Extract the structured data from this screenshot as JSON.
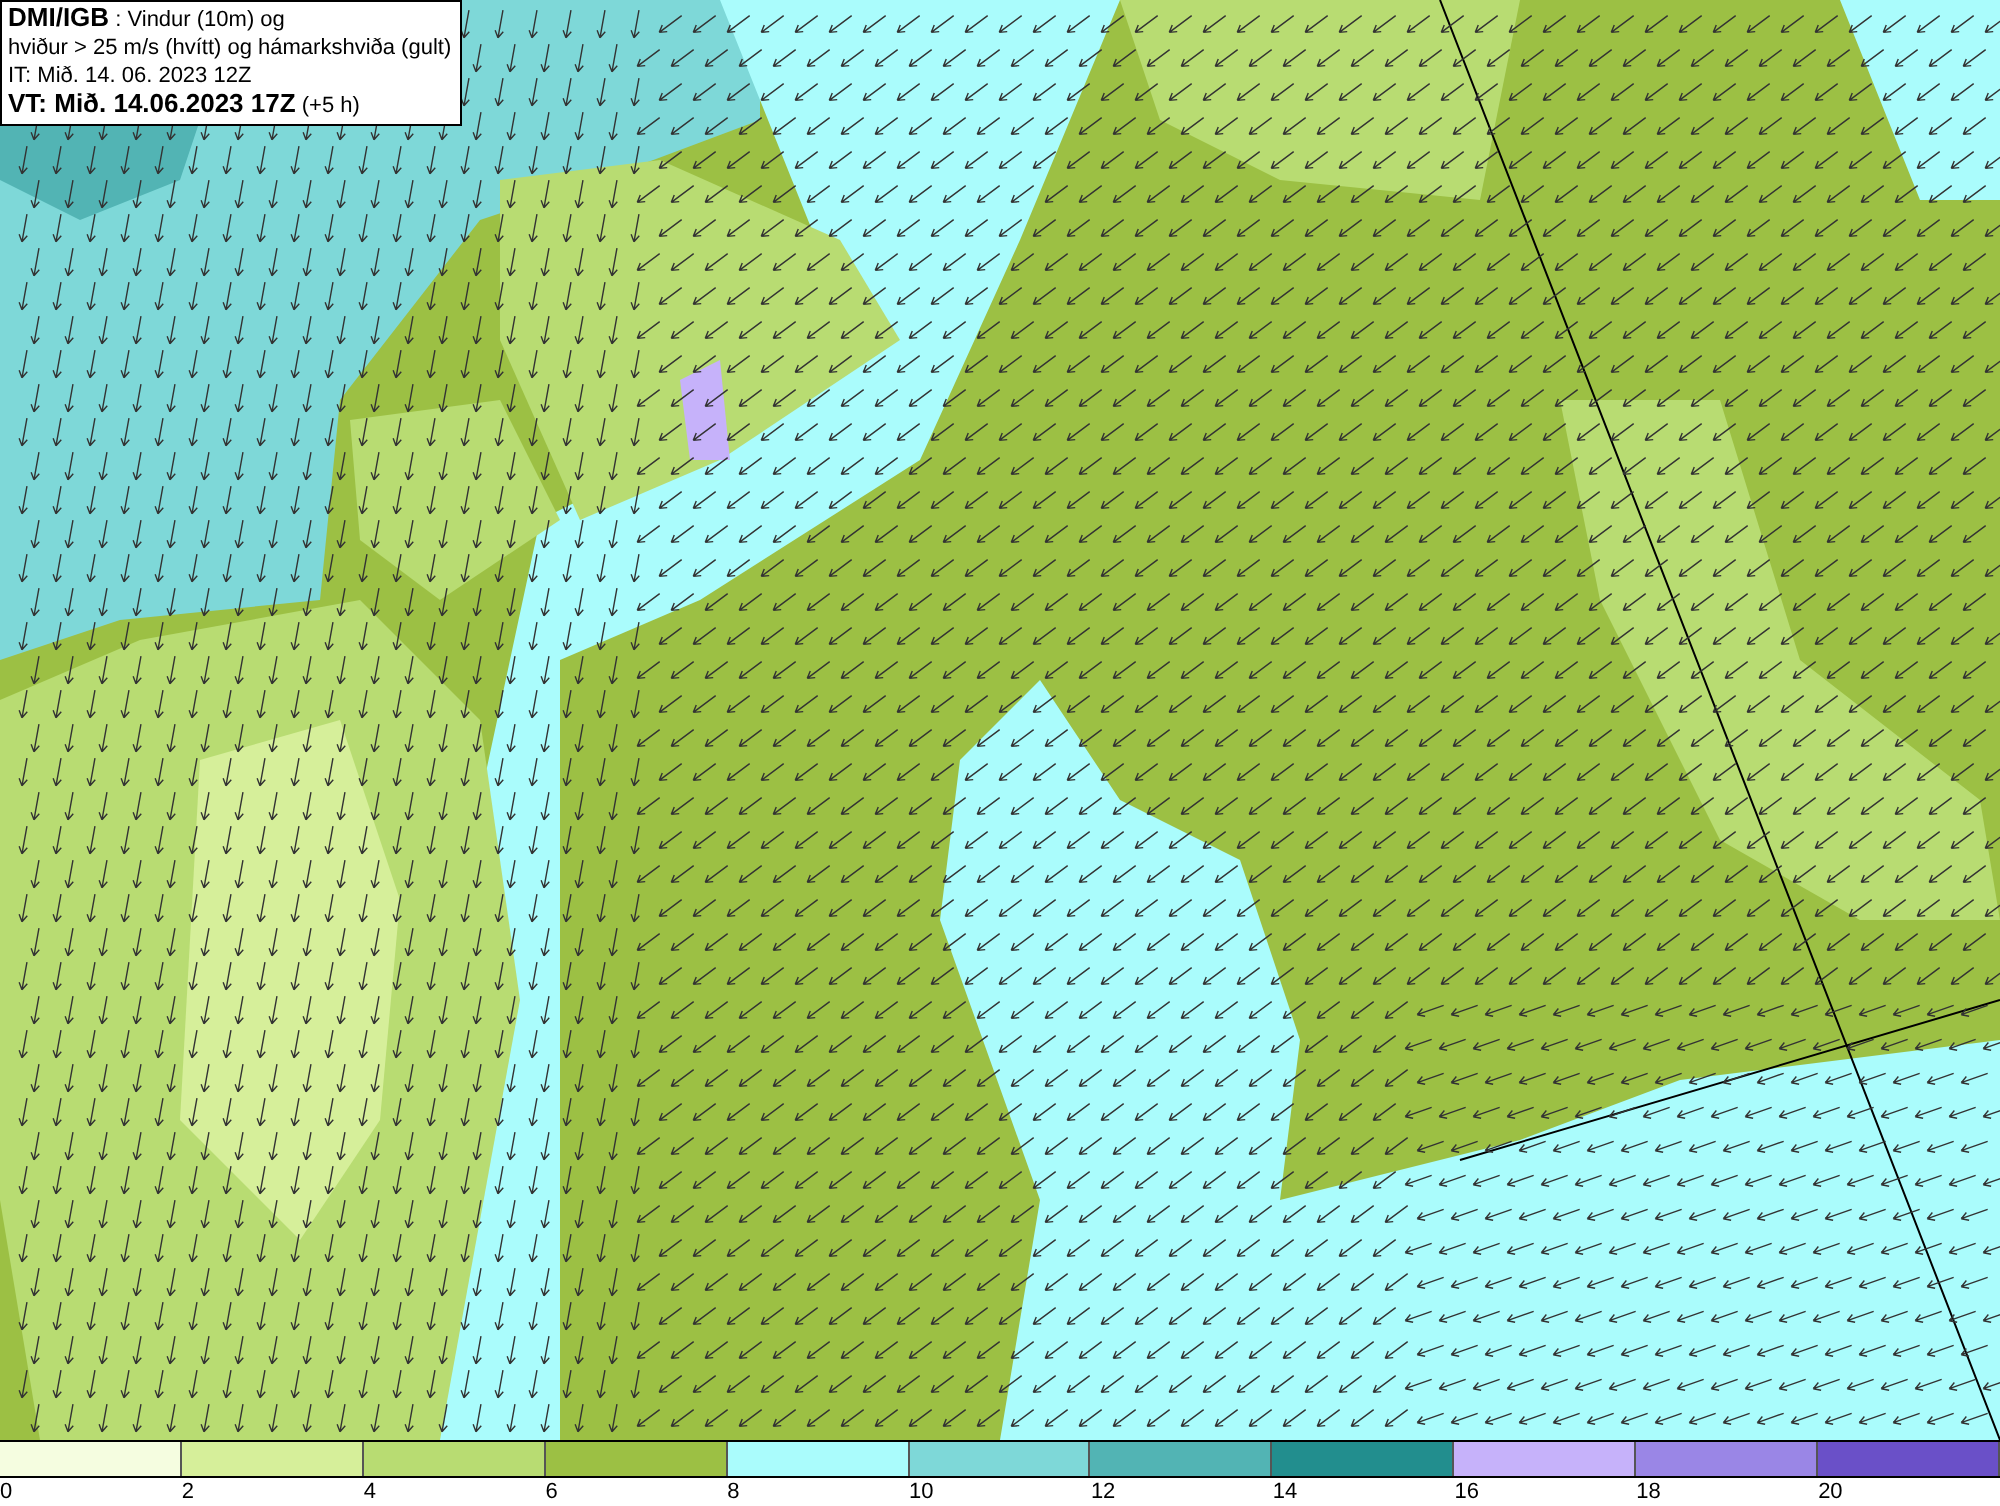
{
  "title_box": {
    "lines": [
      "**DMI/IGB** : Vindur (10m) og",
      "hviður > 25 m/s (hvítt) og hámarkshviða (gult)",
      "IT: Mið. 14. 06. 2023 12Z",
      "**VT: Mið. 14.06.2023 17Z** (+5 h)"
    ]
  },
  "legend": {
    "segments": [
      {
        "color": "#f5fde0"
      },
      {
        "color": "#d6ef9a"
      },
      {
        "color": "#b8dc72"
      },
      {
        "color": "#9cc044"
      },
      {
        "color": "#aafcfc"
      },
      {
        "color": "#7ed8d8"
      },
      {
        "color": "#52b4b4"
      },
      {
        "color": "#228e8e"
      },
      {
        "color": "#c6b2fa"
      },
      {
        "color": "#9a86e6"
      },
      {
        "color": "#6a50c8"
      }
    ],
    "ticks": [
      "0",
      "2",
      "4",
      "6",
      "8",
      "10",
      "12",
      "14",
      "16",
      "18",
      "20"
    ]
  }
}
